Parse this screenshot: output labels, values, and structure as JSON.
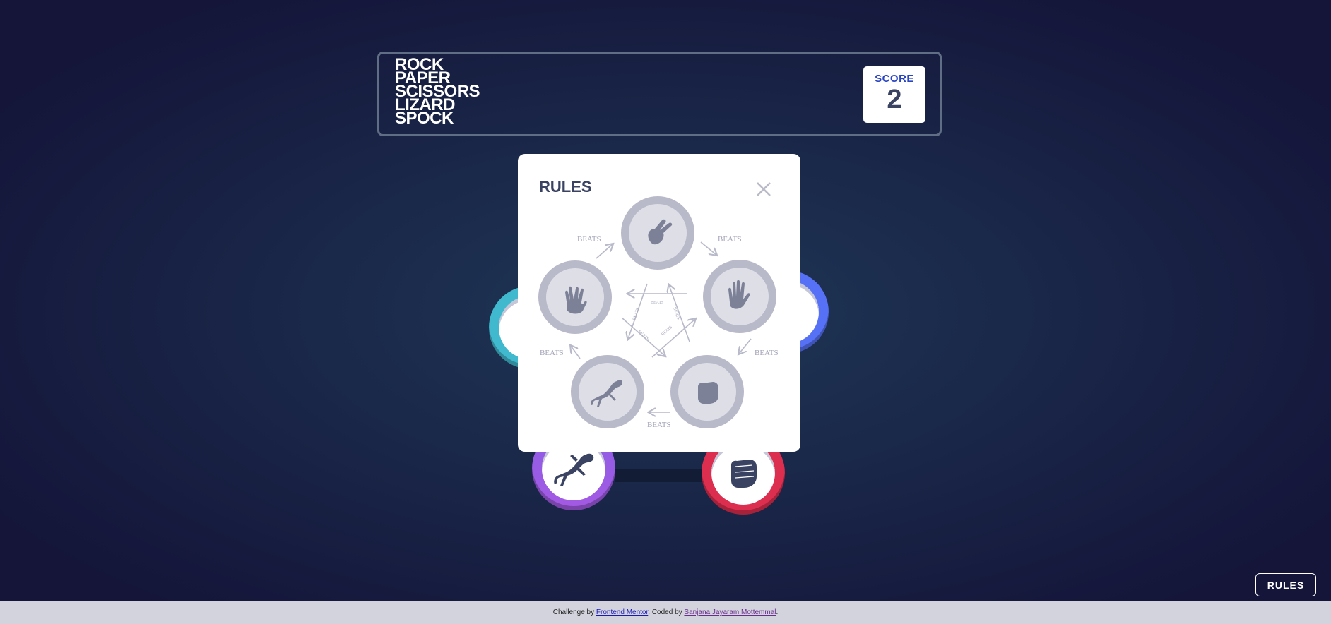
{
  "header": {
    "title_lines": [
      "ROCK",
      "PAPER",
      "SCISSORS",
      "LIZARD",
      "SPOCK"
    ],
    "score_label": "SCORE",
    "score_value": "2"
  },
  "board": {
    "tokens": [
      {
        "name": "scissors",
        "color": "#40b9ce",
        "icon": "scissors-icon"
      },
      {
        "name": "paper",
        "color": "#5671f5",
        "icon": "paper-icon"
      },
      {
        "name": "lizard",
        "color": "#8c5de5",
        "icon": "lizard-icon"
      },
      {
        "name": "rock",
        "color": "#dc2e4e",
        "icon": "rock-icon"
      }
    ]
  },
  "modal": {
    "title": "RULES",
    "beats_label": "BEATS",
    "close_icon": "close-icon",
    "diagram_icons": [
      "scissors-icon",
      "paper-icon",
      "rock-icon",
      "lizard-icon",
      "spock-icon"
    ]
  },
  "rules_button": "RULES",
  "footer": {
    "prefix": "Challenge by ",
    "link1": "Frontend Mentor",
    "middle": ". Coded by ",
    "link2": "Sanjana Jayaram Mottemmal",
    "suffix": "."
  },
  "colors": {
    "background": "#1f3756",
    "score_label": "#2a45c2",
    "dark_text": "#3b4363",
    "diagram_gray": "#b8b9c9"
  }
}
